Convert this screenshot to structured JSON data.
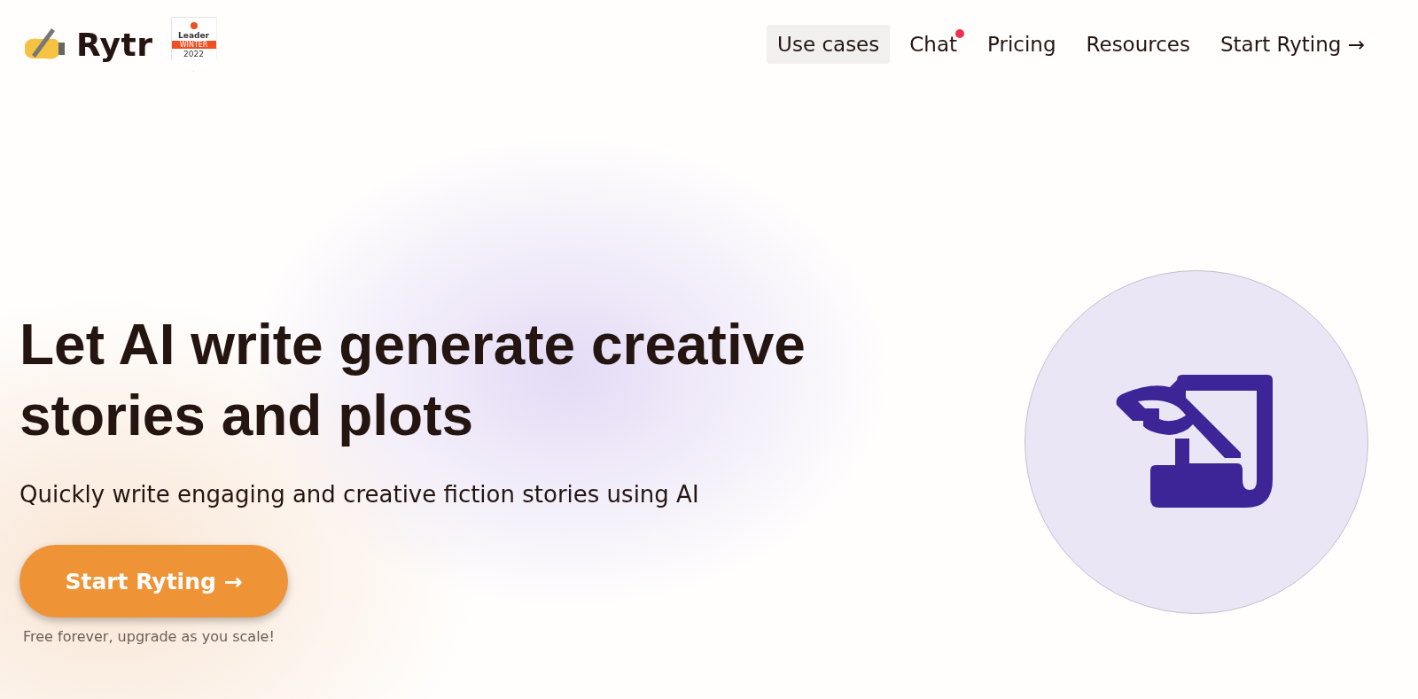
{
  "header": {
    "logo": {
      "text": "Rytr"
    },
    "award_badge": {
      "title": "Leader",
      "ribbon": "WINTER",
      "year": "2022"
    },
    "nav": [
      {
        "label": "Use cases",
        "selected": true,
        "notification": false
      },
      {
        "label": "Chat",
        "selected": false,
        "notification": true
      },
      {
        "label": "Pricing",
        "selected": false,
        "notification": false
      },
      {
        "label": "Resources",
        "selected": false,
        "notification": false
      },
      {
        "label": "Start Ryting →",
        "selected": false,
        "notification": false
      }
    ]
  },
  "hero": {
    "heading": "Let AI write generate creative stories and plots",
    "subheading": "Quickly write engaging and creative fiction stories using AI",
    "cta": "Start Ryting →",
    "note": "Free forever, upgrade as you scale!"
  }
}
